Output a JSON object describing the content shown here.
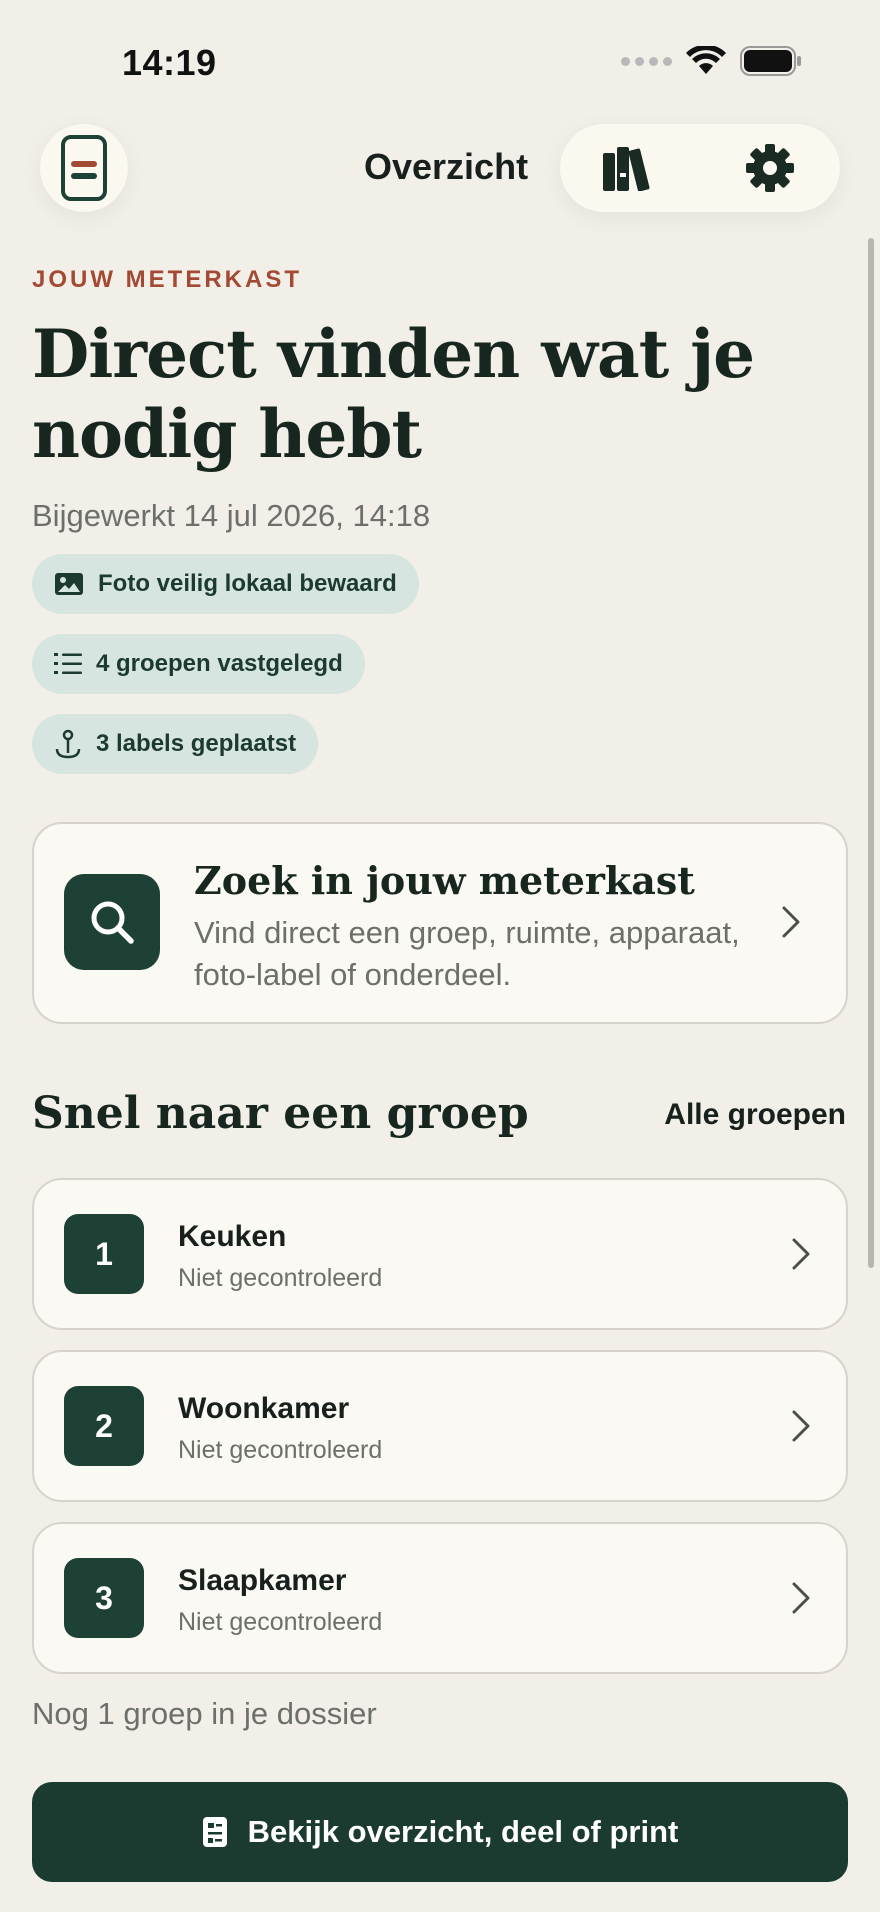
{
  "status_bar": {
    "time": "14:19"
  },
  "nav": {
    "title": "Overzicht",
    "menu_icon": "menu-icon",
    "library_icon": "library-icon",
    "settings_icon": "gear-icon"
  },
  "hero": {
    "eyebrow": "JOUW METERKAST",
    "title": "Direct vinden wat je nodig hebt",
    "updated": "Bijgewerkt 14 jul 2026, 14:18"
  },
  "chips": [
    {
      "icon": "photo-icon",
      "label": "Foto veilig lokaal bewaard"
    },
    {
      "icon": "list-icon",
      "label": "4 groepen vastgelegd"
    },
    {
      "icon": "pin-icon",
      "label": "3 labels geplaatst"
    }
  ],
  "search_card": {
    "title": "Zoek in jouw meterkast",
    "subtitle": "Vind direct een groep, ruimte, apparaat, foto-label of onderdeel."
  },
  "groups": {
    "title": "Snel naar een groep",
    "all_label": "Alle groepen",
    "items": [
      {
        "number": "1",
        "name": "Keuken",
        "status": "Niet gecontroleerd"
      },
      {
        "number": "2",
        "name": "Woonkamer",
        "status": "Niet gecontroleerd"
      },
      {
        "number": "3",
        "name": "Slaapkamer",
        "status": "Niet gecontroleerd"
      }
    ],
    "more": "Nog 1 groep in je dossier"
  },
  "cta": {
    "label": "Bekijk overzicht, deel of print"
  },
  "colors": {
    "background": "#f2efe9",
    "primary": "#1e4136",
    "accent": "#a24a33",
    "chip": "#d6e5df"
  }
}
